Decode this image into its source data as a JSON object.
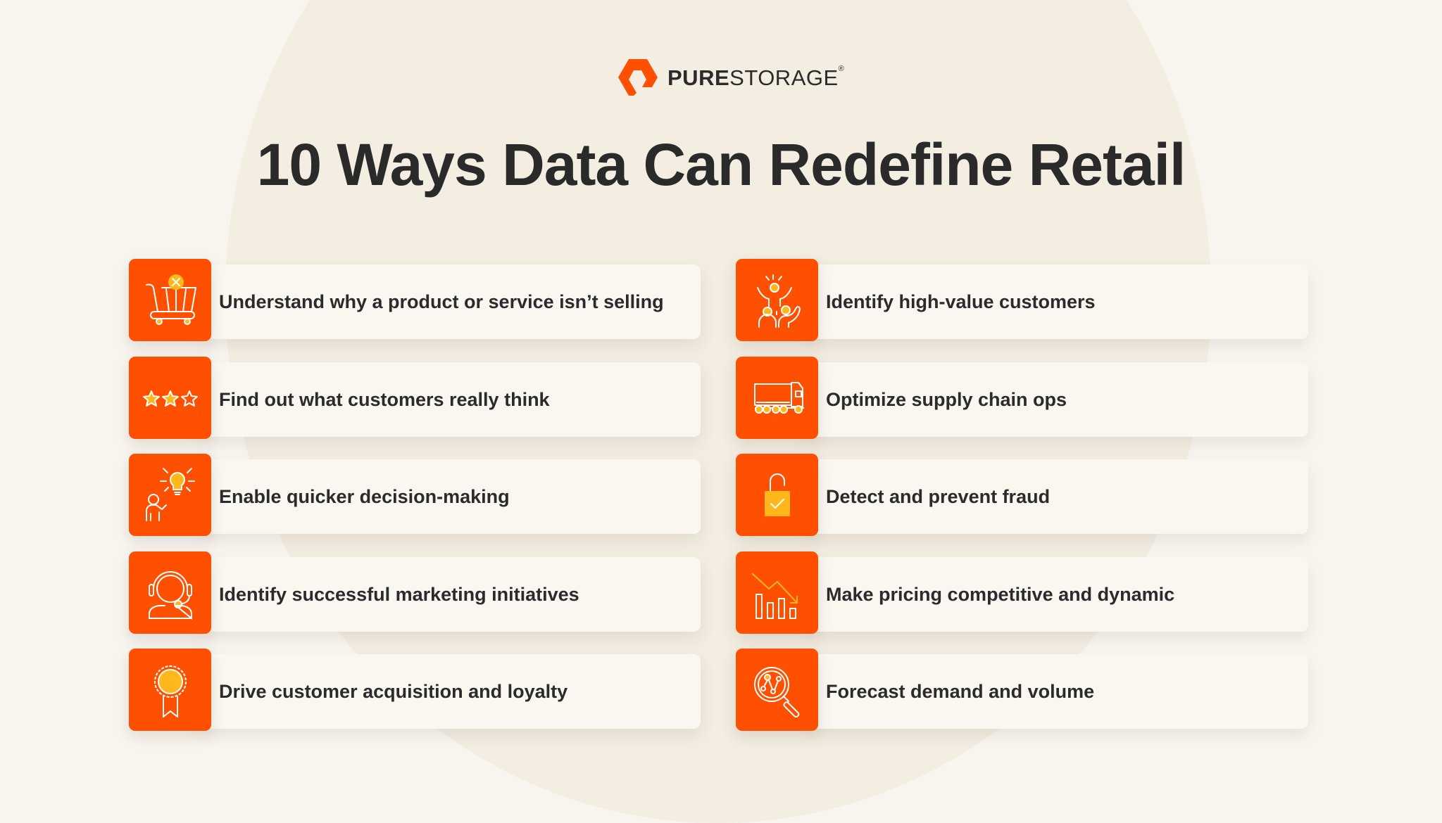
{
  "brand": {
    "name_bold": "PURE",
    "name_light": "STORAGE",
    "registered_mark": "®",
    "accent_color": "#fe5000",
    "highlight_color": "#ffb81c"
  },
  "title": "10 Ways Data Can Redefine Retail",
  "items": [
    {
      "icon": "shopping-cart-x-icon",
      "label": "Understand why a product or service isn’t selling"
    },
    {
      "icon": "star-rating-icon",
      "label": "Find out what customers really think"
    },
    {
      "icon": "person-lightbulb-icon",
      "label": "Enable quicker decision-making"
    },
    {
      "icon": "headset-agent-icon",
      "label": "Identify successful marketing initiatives"
    },
    {
      "icon": "award-ribbon-icon",
      "label": "Drive customer acquisition and loyalty"
    },
    {
      "icon": "cheering-people-icon",
      "label": "Identify high-value customers"
    },
    {
      "icon": "delivery-truck-icon",
      "label": "Optimize supply chain ops"
    },
    {
      "icon": "padlock-check-icon",
      "label": "Detect and prevent fraud"
    },
    {
      "icon": "price-chart-down-icon",
      "label": "Make pricing competitive and dynamic"
    },
    {
      "icon": "magnifier-analytics-icon",
      "label": "Forecast demand and volume"
    }
  ]
}
